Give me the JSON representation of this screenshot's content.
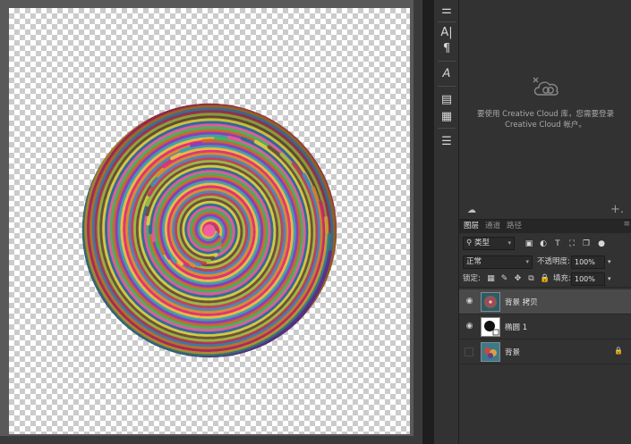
{
  "cc_library": {
    "message": "要使用 Creative Cloud 库，您需要登录 Creative Cloud 帐户。",
    "icon": "creative-cloud-icon",
    "add": "+."
  },
  "tools": [
    {
      "name": "adjust-icon",
      "glyph": "⚌"
    },
    {
      "name": "character-icon",
      "glyph": "A|"
    },
    {
      "name": "paragraph-icon",
      "glyph": "¶"
    },
    {
      "name": "glyph-icon",
      "glyph": "𝘈"
    },
    {
      "name": "libraries-icon",
      "glyph": "▤"
    },
    {
      "name": "document-icon",
      "glyph": "▦"
    },
    {
      "name": "properties-icon",
      "glyph": "☰"
    }
  ],
  "layers_panel": {
    "tabs": [
      "图层",
      "通道",
      "路径"
    ],
    "active_tab": "图层",
    "filter": {
      "label": "类型",
      "icon": "search-icon"
    },
    "blend_mode": "正常",
    "opacity_label": "不透明度:",
    "opacity_value": "100%",
    "lock_label": "锁定:",
    "fill_label": "填充:",
    "fill_value": "100%",
    "layers": [
      {
        "name": "背景 拷贝",
        "visible": true,
        "selected": true,
        "locked": false
      },
      {
        "name": "椭圆 1",
        "visible": true,
        "selected": false,
        "locked": false
      },
      {
        "name": "背景",
        "visible": false,
        "selected": false,
        "locked": true
      }
    ]
  },
  "colors": {
    "canvas_bg": "#595959",
    "panel_bg": "#323232",
    "selected_layer": "#4a4a4a",
    "text": "#e0e0e0"
  }
}
